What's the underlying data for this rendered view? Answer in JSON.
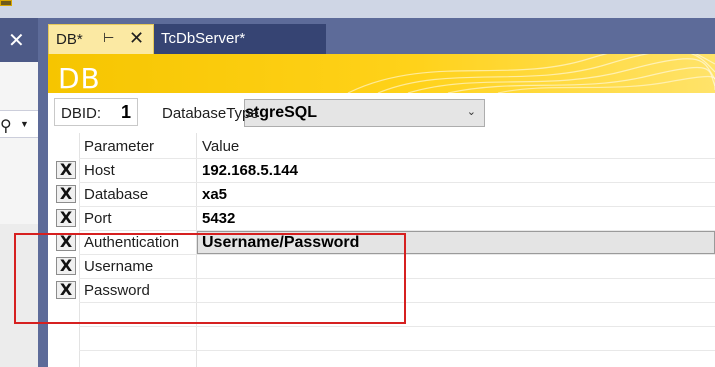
{
  "window": {
    "left_close": "✕"
  },
  "tabs": [
    {
      "label": "DB*",
      "pin": "⊢",
      "close": "✕"
    },
    {
      "label": "TcDbServer*"
    }
  ],
  "banner": {
    "title": "DB"
  },
  "header": {
    "dbid_label": "DBID:",
    "dbid_value": "1",
    "database_type_label": "DatabaseType",
    "database_type_value": "stgreSQL"
  },
  "grid": {
    "columns": [
      "Parameter",
      "Value"
    ],
    "rows": [
      {
        "parameter": "Host",
        "value": "192.168.5.144"
      },
      {
        "parameter": "Database",
        "value": "xa5"
      },
      {
        "parameter": "Port",
        "value": "5432"
      },
      {
        "parameter": "Authentication",
        "value": "Username/Password"
      },
      {
        "parameter": "Username",
        "value": ""
      },
      {
        "parameter": "Password",
        "value": ""
      }
    ],
    "remove_glyph": "X"
  },
  "colors": {
    "banner": "#ffd21a",
    "tab_active": "#fbe9a3",
    "tab_inactive": "#364473",
    "frame": "#5d6b99",
    "highlight": "#d62020"
  }
}
